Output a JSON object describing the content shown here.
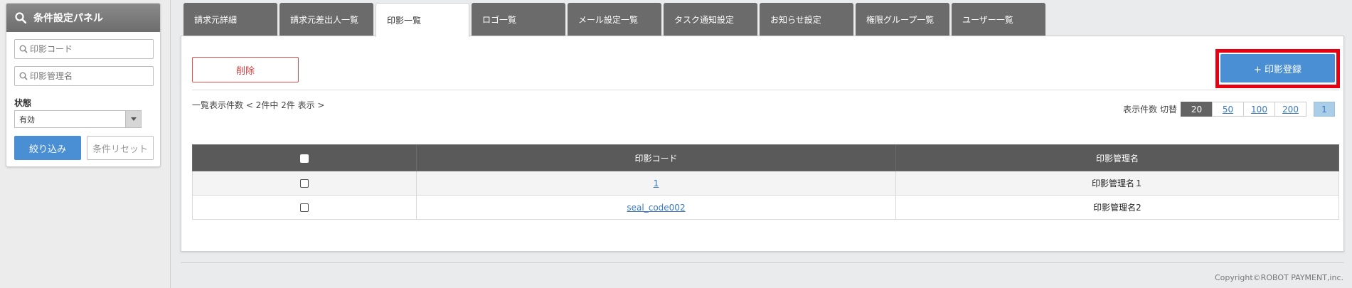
{
  "sidebar": {
    "panel_title": "条件設定パネル",
    "seal_code_placeholder": "印影コード",
    "seal_name_placeholder": "印影管理名",
    "status_label": "状態",
    "status_value": "有効",
    "filter_label": "絞り込み",
    "reset_label": "条件リセット"
  },
  "tabs": [
    {
      "label": "請求元詳細",
      "active": false
    },
    {
      "label": "請求元差出人一覧",
      "active": false
    },
    {
      "label": "印影一覧",
      "active": true
    },
    {
      "label": "ロゴ一覧",
      "active": false
    },
    {
      "label": "メール設定一覧",
      "active": false
    },
    {
      "label": "タスク通知設定",
      "active": false
    },
    {
      "label": "お知らせ設定",
      "active": false
    },
    {
      "label": "権限グループ一覧",
      "active": false
    },
    {
      "label": "ユーザー一覧",
      "active": false
    }
  ],
  "toolbar": {
    "delete_label": "削除",
    "register_label": "+ 印影登録"
  },
  "list": {
    "count_text": "一覧表示件数 < 2件中 2件 表示 >",
    "per_page_label": "表示件数 切替",
    "per_page_options": [
      "20",
      "50",
      "100",
      "200"
    ],
    "current_page": "1"
  },
  "table": {
    "headers": {
      "code": "印影コード",
      "name": "印影管理名"
    },
    "rows": [
      {
        "code": "1",
        "name": "印影管理名１"
      },
      {
        "code": "seal_code002",
        "name": "印影管理名2"
      }
    ]
  },
  "footer": {
    "copyright": "Copyright©ROBOT PAYMENT,inc."
  },
  "colors": {
    "primary": "#4a8fd3",
    "highlight": "#e60012",
    "danger": "#e03c3c",
    "tab_inactive": "#6b6b6b",
    "table_header": "#5a5a5a"
  }
}
